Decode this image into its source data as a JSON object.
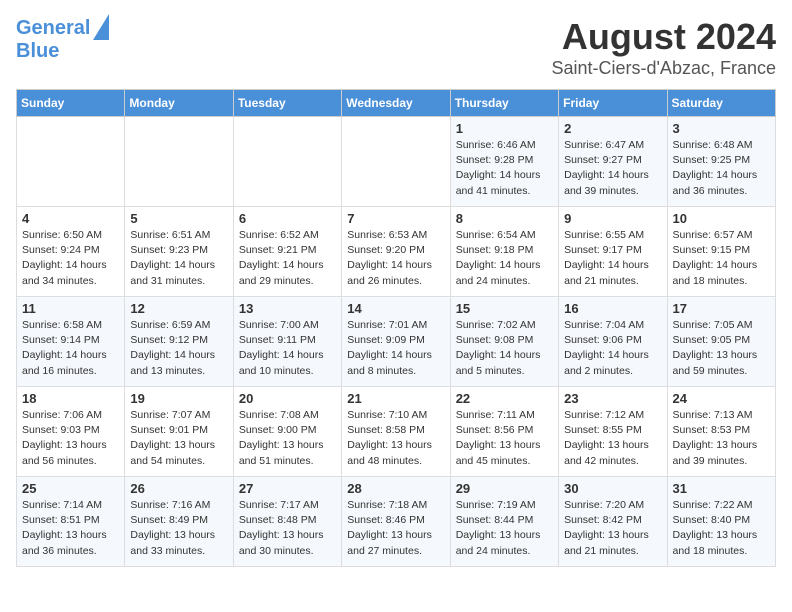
{
  "logo": {
    "line1": "General",
    "line2": "Blue"
  },
  "title": "August 2024",
  "subtitle": "Saint-Ciers-d'Abzac, France",
  "headers": [
    "Sunday",
    "Monday",
    "Tuesday",
    "Wednesday",
    "Thursday",
    "Friday",
    "Saturday"
  ],
  "weeks": [
    [
      {
        "day": "",
        "info": ""
      },
      {
        "day": "",
        "info": ""
      },
      {
        "day": "",
        "info": ""
      },
      {
        "day": "",
        "info": ""
      },
      {
        "day": "1",
        "info": "Sunrise: 6:46 AM\nSunset: 9:28 PM\nDaylight: 14 hours\nand 41 minutes."
      },
      {
        "day": "2",
        "info": "Sunrise: 6:47 AM\nSunset: 9:27 PM\nDaylight: 14 hours\nand 39 minutes."
      },
      {
        "day": "3",
        "info": "Sunrise: 6:48 AM\nSunset: 9:25 PM\nDaylight: 14 hours\nand 36 minutes."
      }
    ],
    [
      {
        "day": "4",
        "info": "Sunrise: 6:50 AM\nSunset: 9:24 PM\nDaylight: 14 hours\nand 34 minutes."
      },
      {
        "day": "5",
        "info": "Sunrise: 6:51 AM\nSunset: 9:23 PM\nDaylight: 14 hours\nand 31 minutes."
      },
      {
        "day": "6",
        "info": "Sunrise: 6:52 AM\nSunset: 9:21 PM\nDaylight: 14 hours\nand 29 minutes."
      },
      {
        "day": "7",
        "info": "Sunrise: 6:53 AM\nSunset: 9:20 PM\nDaylight: 14 hours\nand 26 minutes."
      },
      {
        "day": "8",
        "info": "Sunrise: 6:54 AM\nSunset: 9:18 PM\nDaylight: 14 hours\nand 24 minutes."
      },
      {
        "day": "9",
        "info": "Sunrise: 6:55 AM\nSunset: 9:17 PM\nDaylight: 14 hours\nand 21 minutes."
      },
      {
        "day": "10",
        "info": "Sunrise: 6:57 AM\nSunset: 9:15 PM\nDaylight: 14 hours\nand 18 minutes."
      }
    ],
    [
      {
        "day": "11",
        "info": "Sunrise: 6:58 AM\nSunset: 9:14 PM\nDaylight: 14 hours\nand 16 minutes."
      },
      {
        "day": "12",
        "info": "Sunrise: 6:59 AM\nSunset: 9:12 PM\nDaylight: 14 hours\nand 13 minutes."
      },
      {
        "day": "13",
        "info": "Sunrise: 7:00 AM\nSunset: 9:11 PM\nDaylight: 14 hours\nand 10 minutes."
      },
      {
        "day": "14",
        "info": "Sunrise: 7:01 AM\nSunset: 9:09 PM\nDaylight: 14 hours\nand 8 minutes."
      },
      {
        "day": "15",
        "info": "Sunrise: 7:02 AM\nSunset: 9:08 PM\nDaylight: 14 hours\nand 5 minutes."
      },
      {
        "day": "16",
        "info": "Sunrise: 7:04 AM\nSunset: 9:06 PM\nDaylight: 14 hours\nand 2 minutes."
      },
      {
        "day": "17",
        "info": "Sunrise: 7:05 AM\nSunset: 9:05 PM\nDaylight: 13 hours\nand 59 minutes."
      }
    ],
    [
      {
        "day": "18",
        "info": "Sunrise: 7:06 AM\nSunset: 9:03 PM\nDaylight: 13 hours\nand 56 minutes."
      },
      {
        "day": "19",
        "info": "Sunrise: 7:07 AM\nSunset: 9:01 PM\nDaylight: 13 hours\nand 54 minutes."
      },
      {
        "day": "20",
        "info": "Sunrise: 7:08 AM\nSunset: 9:00 PM\nDaylight: 13 hours\nand 51 minutes."
      },
      {
        "day": "21",
        "info": "Sunrise: 7:10 AM\nSunset: 8:58 PM\nDaylight: 13 hours\nand 48 minutes."
      },
      {
        "day": "22",
        "info": "Sunrise: 7:11 AM\nSunset: 8:56 PM\nDaylight: 13 hours\nand 45 minutes."
      },
      {
        "day": "23",
        "info": "Sunrise: 7:12 AM\nSunset: 8:55 PM\nDaylight: 13 hours\nand 42 minutes."
      },
      {
        "day": "24",
        "info": "Sunrise: 7:13 AM\nSunset: 8:53 PM\nDaylight: 13 hours\nand 39 minutes."
      }
    ],
    [
      {
        "day": "25",
        "info": "Sunrise: 7:14 AM\nSunset: 8:51 PM\nDaylight: 13 hours\nand 36 minutes."
      },
      {
        "day": "26",
        "info": "Sunrise: 7:16 AM\nSunset: 8:49 PM\nDaylight: 13 hours\nand 33 minutes."
      },
      {
        "day": "27",
        "info": "Sunrise: 7:17 AM\nSunset: 8:48 PM\nDaylight: 13 hours\nand 30 minutes."
      },
      {
        "day": "28",
        "info": "Sunrise: 7:18 AM\nSunset: 8:46 PM\nDaylight: 13 hours\nand 27 minutes."
      },
      {
        "day": "29",
        "info": "Sunrise: 7:19 AM\nSunset: 8:44 PM\nDaylight: 13 hours\nand 24 minutes."
      },
      {
        "day": "30",
        "info": "Sunrise: 7:20 AM\nSunset: 8:42 PM\nDaylight: 13 hours\nand 21 minutes."
      },
      {
        "day": "31",
        "info": "Sunrise: 7:22 AM\nSunset: 8:40 PM\nDaylight: 13 hours\nand 18 minutes."
      }
    ]
  ]
}
